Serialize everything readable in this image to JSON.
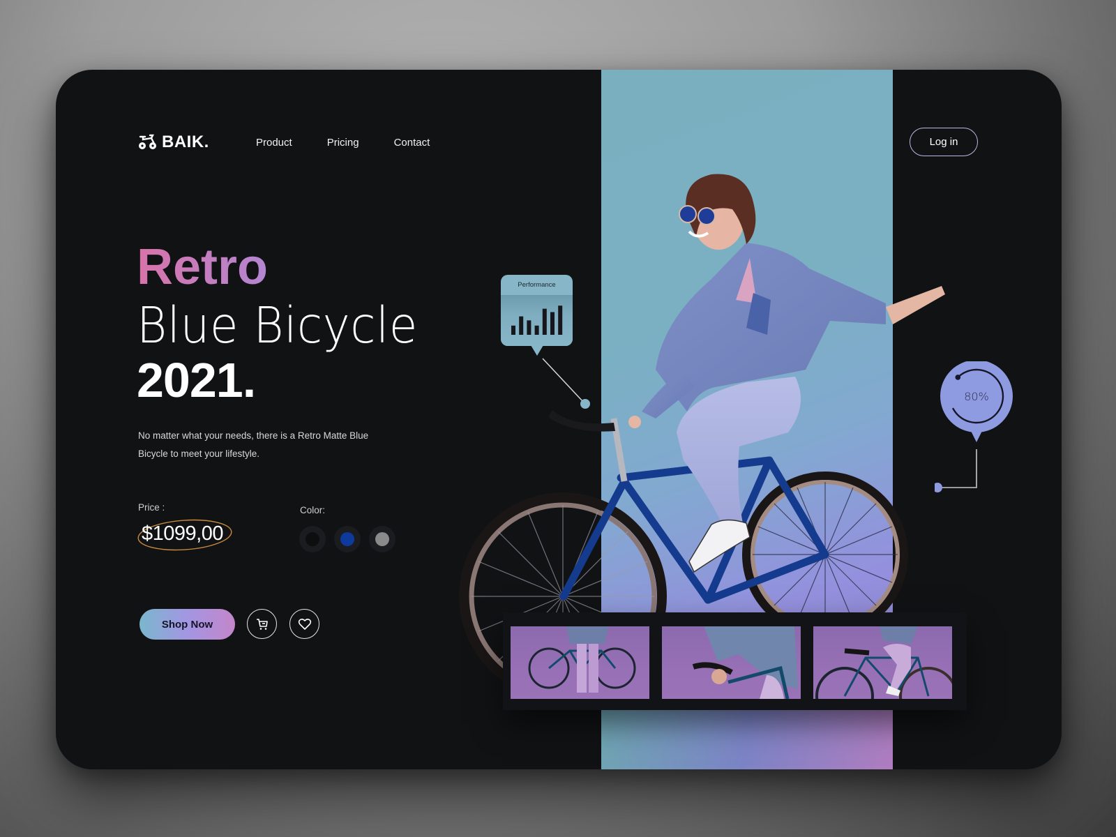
{
  "brand": {
    "name": "BAIK.",
    "logo_icon": "bike-icon"
  },
  "nav": {
    "items": [
      {
        "label": "Product"
      },
      {
        "label": "Pricing"
      },
      {
        "label": "Contact"
      }
    ],
    "login_label": "Log in"
  },
  "hero": {
    "title_line1": "Retro",
    "title_line2": "Blue Bicycle",
    "title_line3": "2021.",
    "description": "No matter what your needs, there is a Retro Matte Blue Bicycle to meet your lifestyle.",
    "price_label": "Price :",
    "price": "$1099,00",
    "color_label": "Color:",
    "colors": [
      {
        "name": "black",
        "hex": "#0d0e10"
      },
      {
        "name": "blue",
        "hex": "#0d3a9c"
      },
      {
        "name": "gray",
        "hex": "#8a8a8a"
      }
    ],
    "shop_label": "Shop Now",
    "cart_icon": "cart-icon",
    "wishlist_icon": "heart-icon"
  },
  "performance": {
    "title": "Performance",
    "bars": [
      0.3,
      0.6,
      0.47,
      0.3,
      0.85,
      0.74,
      0.95
    ]
  },
  "progress": {
    "value": 80,
    "label": "80%"
  },
  "gallery": {
    "thumbnails": [
      {
        "alt": "Woman standing with bicycle"
      },
      {
        "alt": "Hands on handlebars close-up"
      },
      {
        "alt": "Woman riding bicycle"
      }
    ]
  },
  "colors": {
    "background": "#111214",
    "accent_teal": "#7ab7cd",
    "accent_purple": "#a396e2",
    "accent_pink": "#d873a9",
    "price_ring": "#c88a3c",
    "progress_fill": "#8f9be0"
  }
}
